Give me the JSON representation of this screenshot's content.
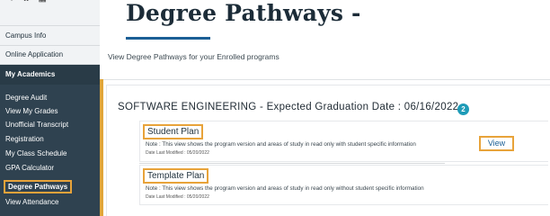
{
  "sidebar": {
    "top_icons": [
      "user-icon",
      "download-icon",
      "calendar-icon"
    ],
    "links": [
      "Campus Info",
      "Online Application"
    ],
    "section_header": "My Academics",
    "items": [
      {
        "label": "Degree Audit"
      },
      {
        "label": "View My Grades"
      },
      {
        "label": "Unofficial Transcript"
      },
      {
        "label": "Registration"
      },
      {
        "label": "My Class Schedule"
      },
      {
        "label": "GPA Calculator"
      },
      {
        "label": "Degree Pathways",
        "active": true
      },
      {
        "label": "View Attendance"
      }
    ]
  },
  "main": {
    "title": "Degree Pathways -",
    "subtitle": "View Degree Pathways for your Enrolled programs",
    "program": {
      "title": "SOFTWARE ENGINEERING - Expected Graduation Date : 06/16/2022",
      "badge_count": "2"
    },
    "plans": [
      {
        "title": "Student Plan",
        "note": "Note : This view shows the program version and areas of study in read only with student specific information",
        "date": "Date Last Modified : 05/20/2022"
      },
      {
        "title": "Template Plan",
        "note": "Note : This view shows the program version and areas of study in read only without student specific information",
        "date": "Date Last Modified : 05/20/2022"
      }
    ],
    "view_button": "View"
  },
  "colors": {
    "accent": "#e1a63a",
    "brand": "#1b5f95",
    "sidebar_dark": "#2f4250",
    "badge": "#1e9bb7"
  }
}
